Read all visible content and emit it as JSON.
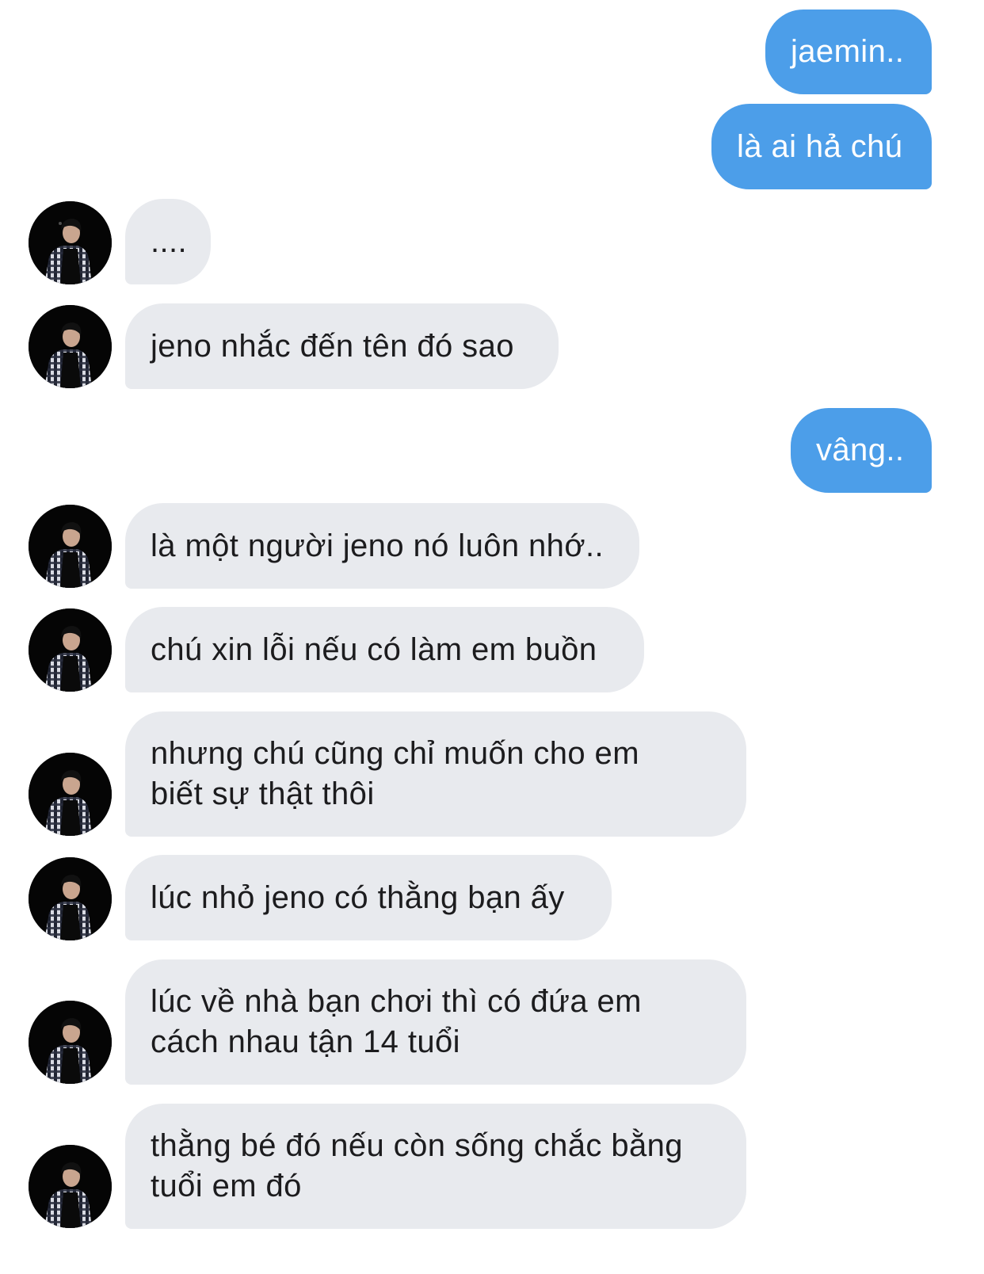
{
  "chat": {
    "messages": [
      {
        "from": "me",
        "text": "jaemin.."
      },
      {
        "from": "me",
        "text": "là ai hả chú"
      },
      {
        "from": "other",
        "text": "...."
      },
      {
        "from": "other",
        "text": "jeno nhắc đến tên đó sao"
      },
      {
        "from": "me",
        "text": "vâng.."
      },
      {
        "from": "other",
        "text": "là một người jeno nó luôn nhớ.."
      },
      {
        "from": "other",
        "text": "chú xin lỗi nếu có làm em buồn"
      },
      {
        "from": "other",
        "text": "nhưng chú cũng chỉ muốn cho em biết sự thật thôi"
      },
      {
        "from": "other",
        "text": "lúc nhỏ jeno có thằng bạn ấy"
      },
      {
        "from": "other",
        "text": "lúc về nhà bạn chơi thì có đứa em cách nhau tận 14 tuổi"
      },
      {
        "from": "other",
        "text": "thằng bé đó nếu còn sống chắc bằng tuổi em đó"
      }
    ]
  },
  "colors": {
    "outgoing_bubble": "#4c9ee9",
    "incoming_bubble": "#e8eaee",
    "background": "#ffffff"
  },
  "icons": {
    "contact_avatar": "avatar-photo-person-dark"
  }
}
